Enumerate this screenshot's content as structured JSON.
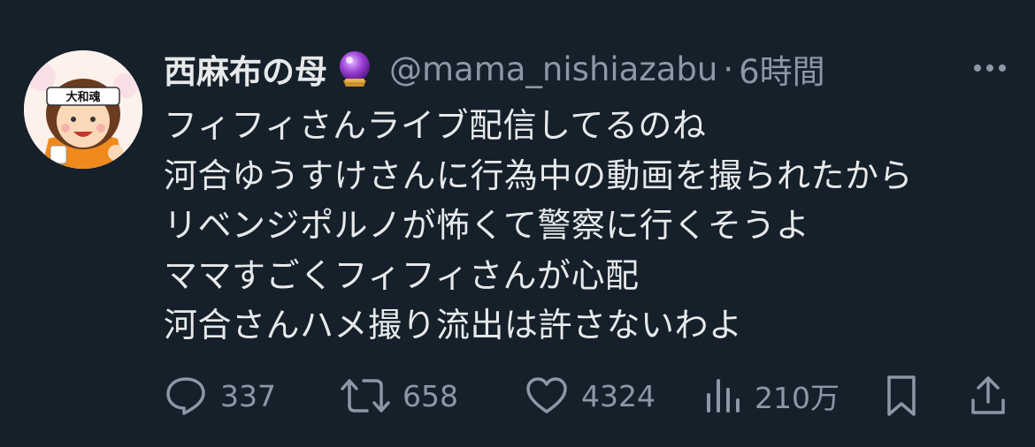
{
  "author": {
    "display_name": "西麻布の母",
    "badge_icon": "crystal-ball-icon",
    "handle": "@mama_nishiazabu",
    "separator": "·",
    "time": "6時間",
    "avatar_text": "大和魂"
  },
  "tweet": {
    "lines": [
      "フィフィさんライブ配信してるのね",
      "河合ゆうすけさんに行為中の動画を撮られたから",
      "リベンジポルノが怖くて警察に行くそうよ",
      "ママすごくフィフィさんが心配",
      "河合さんハメ撮り流出は許さないわよ"
    ]
  },
  "actions": {
    "reply": {
      "icon": "reply-icon",
      "count": "337"
    },
    "retweet": {
      "icon": "retweet-icon",
      "count": "658"
    },
    "like": {
      "icon": "heart-icon",
      "count": "4324"
    },
    "views": {
      "icon": "views-icon",
      "count": "210万"
    },
    "bookmark": {
      "icon": "bookmark-icon"
    },
    "share": {
      "icon": "share-icon"
    }
  },
  "colors": {
    "background": "#15202b",
    "text": "#e7e9ea",
    "muted": "#8b98a5"
  }
}
